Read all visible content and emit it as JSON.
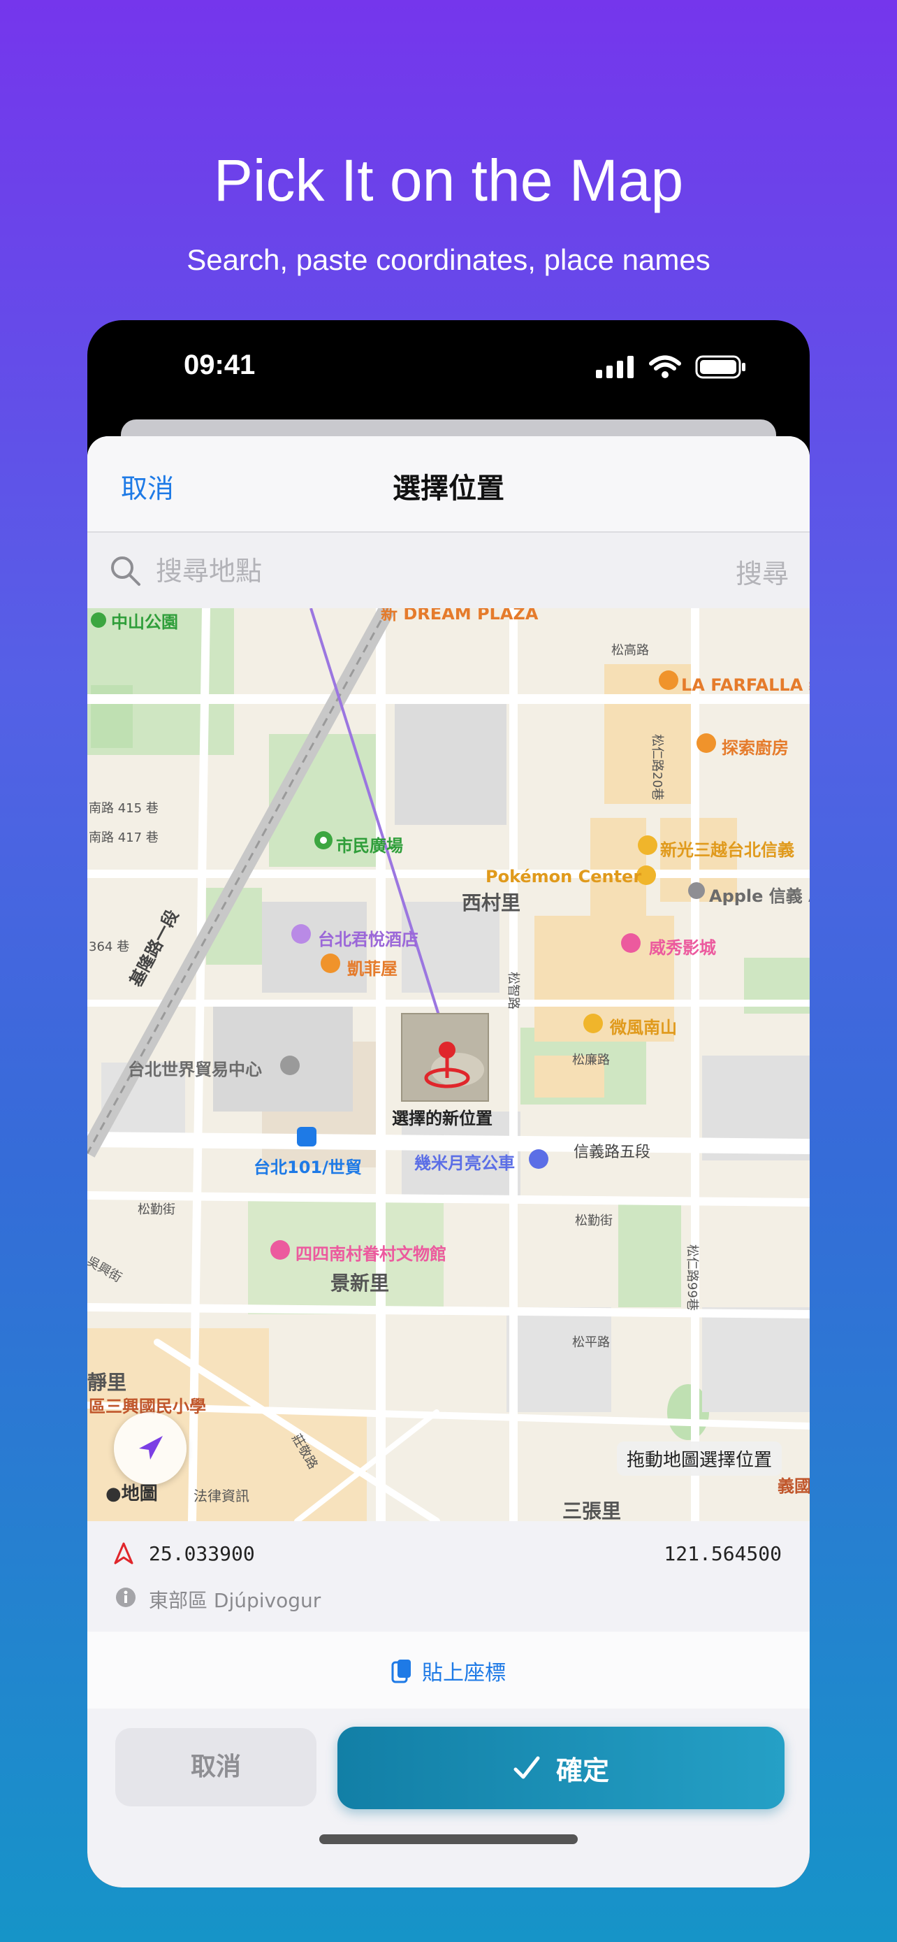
{
  "promo": {
    "title": "Pick It on the Map",
    "subtitle": "Search, paste coordinates, place names"
  },
  "status_bar": {
    "time": "09:41"
  },
  "nav": {
    "cancel_label": "取消",
    "title": "選擇位置"
  },
  "search": {
    "placeholder": "搜尋地點",
    "button_label": "搜尋"
  },
  "map": {
    "pois": {
      "zhongshan_park": "中山公園",
      "dream_plaza": "新 DREAM PLAZA",
      "la_farfalla": "LA FARFALLA 義",
      "explore_kitchen": "探索廚房",
      "citizen_square": "市民廣場",
      "pokemon_center": "Pokémon Center",
      "shin_kong": "新光三越台北信義",
      "apple_store": "Apple 信義 A",
      "grand_hyatt": "台北君悅酒店",
      "kaifei": "凱菲屋",
      "vieshow": "威秀影城",
      "weifeng": "微風南山",
      "world_trade": "台北世界貿易中心",
      "selected_place": "選擇的新位置",
      "taipei101_station": "台北101/世貿",
      "jimi_moon": "幾米月亮公車",
      "sisinan": "四四南村眷村文物館",
      "sanxing_school": "區三興國民小學"
    },
    "districts": {
      "xicun": "西村里",
      "jingxin": "景新里",
      "jing_partial": "靜里",
      "sanzhang": "三張里",
      "yi_partial": "義國"
    },
    "streets": {
      "songgao": "松高路",
      "songren": "松仁路20巷",
      "songzhi": "松智路",
      "songlian": "松廉路",
      "xinyi5": "信義路五段",
      "songqin": "松勤街",
      "songping": "松平路",
      "songren99": "松仁路99巷",
      "keelung": "基隆路一段",
      "lane415": "南路 415 巷",
      "lane417": "南路 417 巷",
      "lane364": "364 巷",
      "wuxing": "吳興街",
      "zhuangjing": "莊敬路",
      "songqin2": "松勤街"
    },
    "attribution": {
      "logo": "地圖",
      "legal": "法律資訊"
    },
    "drag_hint": "拖動地圖選擇位置"
  },
  "coords": {
    "latitude": "25.033900",
    "longitude": "121.564500",
    "place_name": "東部區 Djúpivogur"
  },
  "paste_label": "貼上座標",
  "actions": {
    "cancel_label": "取消",
    "confirm_label": "確定"
  },
  "colors": {
    "accent": "#1e7ae6",
    "confirm": "#1e90b8",
    "pin": "#e0262b"
  }
}
